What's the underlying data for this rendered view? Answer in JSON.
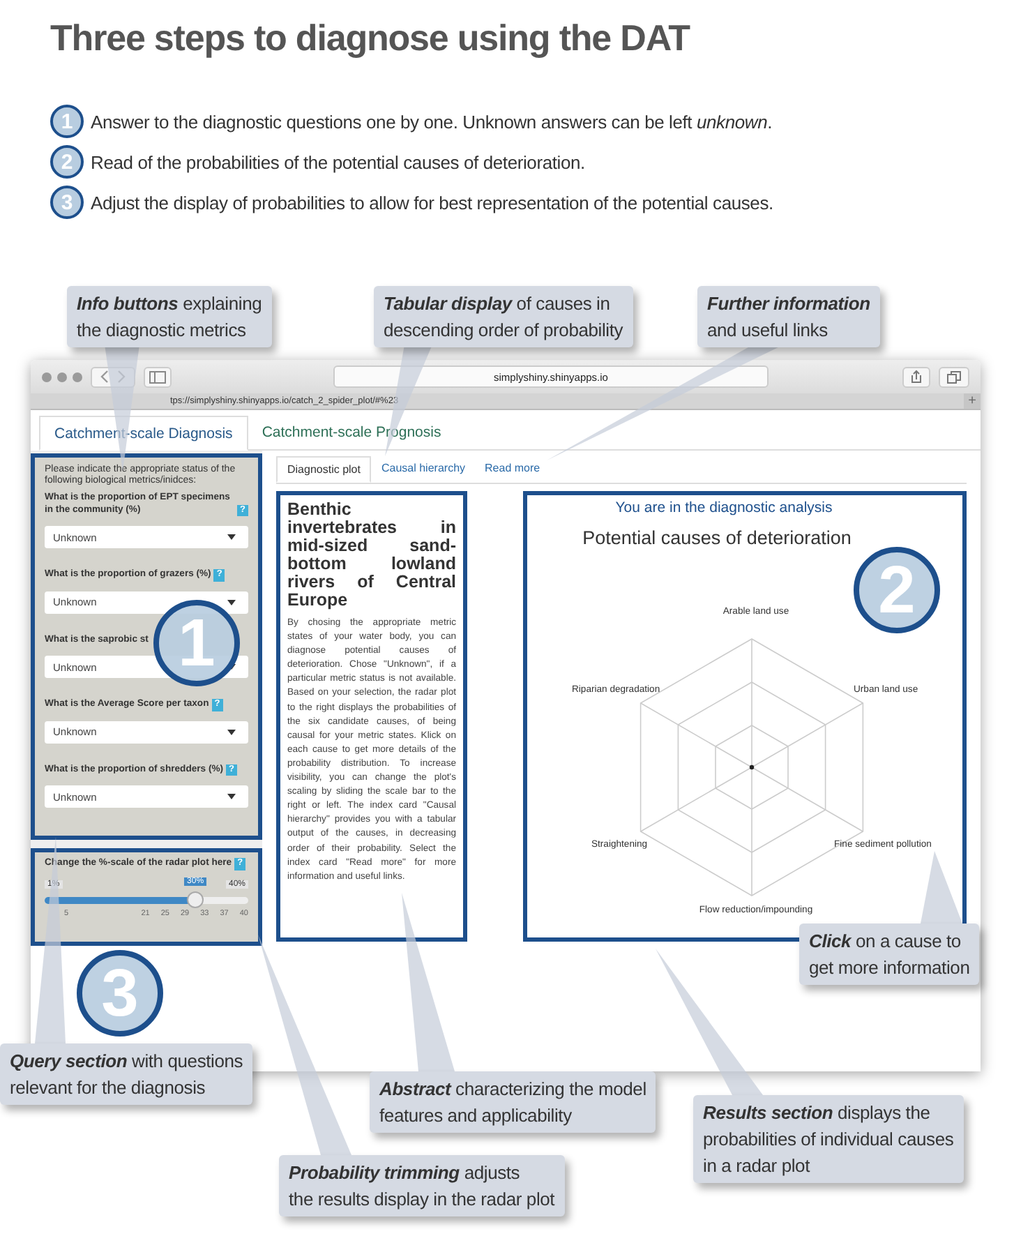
{
  "title": "Three steps to diagnose using the DAT",
  "steps": [
    {
      "number": "1",
      "text": "Answer to the diagnostic questions one by one. Unknown answers can be left *unknown*."
    },
    {
      "number": "2",
      "text": "Read of the probabilities of the potential causes of deterioration."
    },
    {
      "number": "3",
      "text": "Adjust the display of probabilities to allow for best representation of the potential causes."
    }
  ],
  "browser": {
    "address": "simplyshiny.shinyapps.io",
    "tab_url": "tps://simplyshiny.shinyapps.io/catch_2_spider_plot/#%23",
    "new_tab": "+"
  },
  "nav_tabs": [
    {
      "label": "Catchment-scale Diagnosis",
      "selected": true
    },
    {
      "label": "Catchment-scale Prognosis",
      "selected": false
    }
  ],
  "query": {
    "intro": "Please indicate the appropriate status of the following biological metrics/inidces:",
    "questions": [
      {
        "label": "What is the proportion of EPT specimens in the community (%)",
        "help": "?",
        "value": "Unknown"
      },
      {
        "label": "What is the proportion of grazers (%)",
        "help": "?",
        "value": "Unknown"
      },
      {
        "label": "What is the saprobic st",
        "value": "Unknown"
      },
      {
        "label": "What is the Average Score per taxon",
        "help": "?",
        "value": "Unknown"
      },
      {
        "label": "What is the proportion of shredders (%)",
        "help": "?",
        "value": "Unknown"
      }
    ]
  },
  "slider": {
    "label": "Change the %-scale of the radar plot here",
    "help": "?",
    "min_label": "1%",
    "value_label": "30%",
    "max_label": "40%",
    "level": 0.74,
    "ticks": [
      "5",
      "21",
      "25",
      "29",
      "33",
      "37",
      "40"
    ]
  },
  "content_tabs": [
    {
      "label": "Diagnostic plot",
      "selected": true
    },
    {
      "label": "Causal hierarchy",
      "selected": false
    },
    {
      "label": "Read more",
      "selected": false
    }
  ],
  "abstract": {
    "title": "Benthic invertebrates in mid-sized sand-bottom lowland rivers of Central Europe",
    "text": "By chosing the appropriate metric states of your water body, you can diagnose potential causes of deterioration. Chose \"Unknown\", if a particular metric status is not available. Based on your selection, the radar plot to the right displays the probabilities of the six candidate causes, of being causal for your metric states. Klick on each cause to get more details of the probability distribution. To increase visibility, you can change the plot's scaling by sliding the scale bar to the right or left. The index card \"Causal hierarchy\" provides you with a tabular output of the causes, in decreasing order of their probability. Select the index card \"Read more\" for more information and useful links."
  },
  "results": {
    "heading": "You are in the diagnostic analysis",
    "title": "Potential causes of deterioration",
    "axes": [
      "Arable land use",
      "Urban land use",
      "Fine sediment pollution",
      "Flow reduction/impounding",
      "Straightening",
      "Riparian degradation"
    ]
  },
  "markers": [
    "1",
    "2",
    "3"
  ],
  "callouts": [
    {
      "lines": [
        "**Info buttons** explaining",
        "the diagnostic metrics"
      ]
    },
    {
      "lines": [
        "**Tabular display** of causes in",
        "descending order of probability"
      ]
    },
    {
      "lines": [
        "**Further information**",
        "and useful links"
      ]
    },
    {
      "lines": [
        "**Click** on a cause to",
        "get more information"
      ]
    },
    {
      "lines": [
        "**Query section** with questions",
        "relevant for the diagnosis"
      ]
    },
    {
      "lines": [
        "**Abstract** characterizing the model",
        "features and applicability"
      ]
    },
    {
      "lines": [
        "**Results section** displays the",
        "probabilities of individual causes",
        "in a radar plot"
      ]
    },
    {
      "lines": [
        "**Probability trimming** adjusts",
        "the results display in the radar plot"
      ]
    }
  ]
}
